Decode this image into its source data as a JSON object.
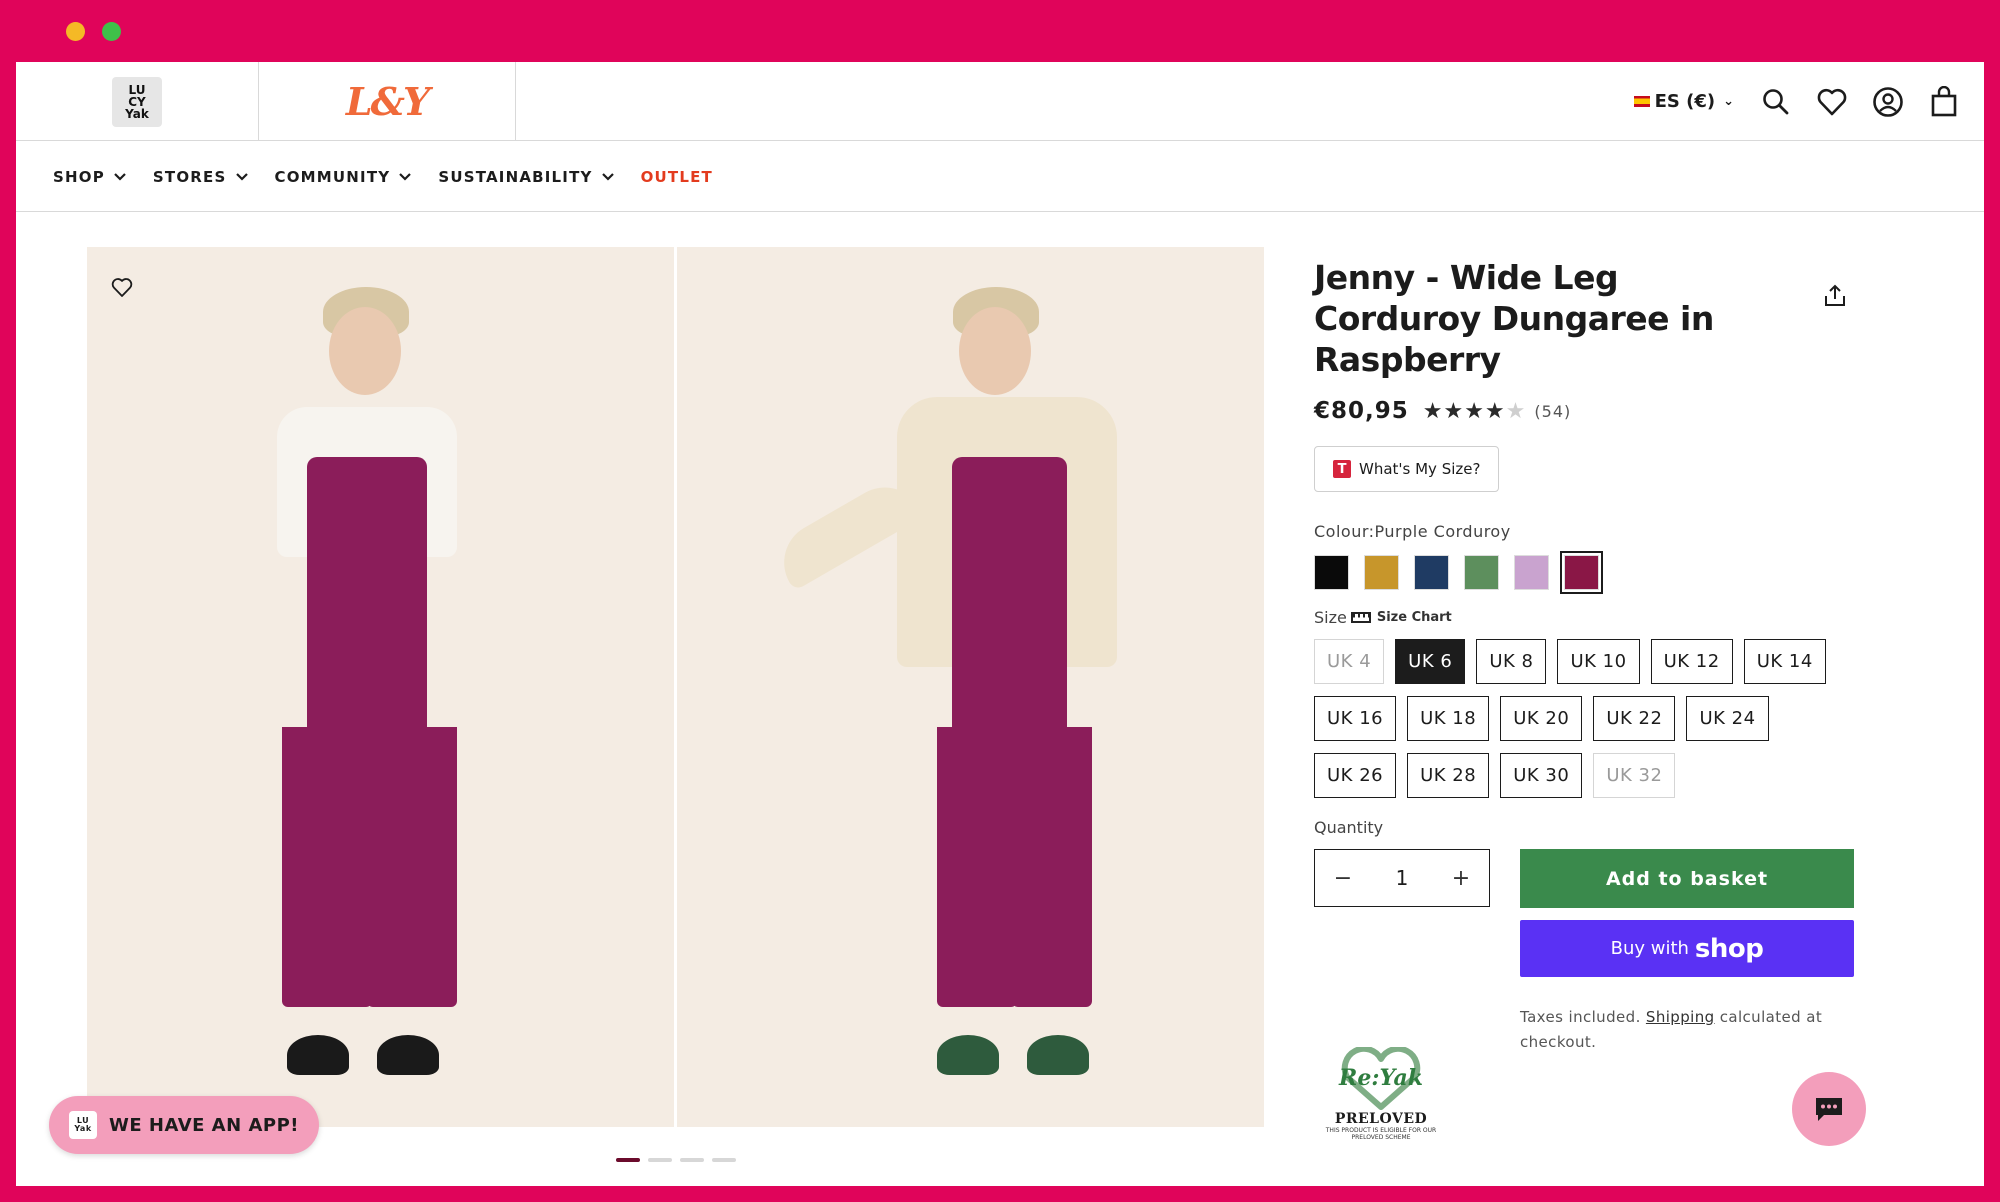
{
  "colors": {
    "frame": "#e0045a",
    "add_button": "#3a8a4c",
    "shop_button": "#5a31f4",
    "outlet": "#e33b1e",
    "app_pill": "#f39ebb"
  },
  "header": {
    "locale": "ES (€)",
    "icons": [
      "search-icon",
      "heart-icon",
      "account-icon",
      "bag-icon"
    ]
  },
  "nav": {
    "items": [
      {
        "label": "SHOP",
        "has_dropdown": true
      },
      {
        "label": "STORES",
        "has_dropdown": true
      },
      {
        "label": "COMMUNITY",
        "has_dropdown": true
      },
      {
        "label": "SUSTAINABILITY",
        "has_dropdown": true
      },
      {
        "label": "OUTLET",
        "has_dropdown": false
      }
    ]
  },
  "gallery": {
    "pages": 4,
    "current_page": 1
  },
  "product": {
    "title": "Jenny - Wide Leg Corduroy Dungaree in Raspberry",
    "price": "€80,95",
    "rating": 4,
    "rating_max": 5,
    "reviews": "(54)",
    "size_tool": "What's My Size?",
    "colour_label": "Colour:",
    "colour_value": "Purple Corduroy",
    "swatches": [
      {
        "name": "black",
        "color": "#0a0a0a"
      },
      {
        "name": "mustard",
        "color": "#c7962b"
      },
      {
        "name": "navy",
        "color": "#1f3b63"
      },
      {
        "name": "green-print",
        "color": "#5d8f5d"
      },
      {
        "name": "lilac-floral",
        "color": "#c9a3cf"
      },
      {
        "name": "raspberry",
        "color": "#8a1746",
        "selected": true
      }
    ],
    "size_label": "Size",
    "size_chart": "Size Chart",
    "sizes": [
      {
        "label": "UK 4",
        "state": "disabled"
      },
      {
        "label": "UK 6",
        "state": "selected"
      },
      {
        "label": "UK 8",
        "state": "available"
      },
      {
        "label": "UK 10",
        "state": "available"
      },
      {
        "label": "UK 12",
        "state": "available"
      },
      {
        "label": "UK 14",
        "state": "available"
      },
      {
        "label": "UK 16",
        "state": "available"
      },
      {
        "label": "UK 18",
        "state": "available"
      },
      {
        "label": "UK 20",
        "state": "available"
      },
      {
        "label": "UK 22",
        "state": "available"
      },
      {
        "label": "UK 24",
        "state": "available"
      },
      {
        "label": "UK 26",
        "state": "available"
      },
      {
        "label": "UK 28",
        "state": "available"
      },
      {
        "label": "UK 30",
        "state": "available"
      },
      {
        "label": "UK 32",
        "state": "disabled"
      }
    ],
    "quantity_label": "Quantity",
    "quantity": "1",
    "add_to_basket": "Add to basket",
    "buy_with": "Buy with",
    "shop_brand": "shop",
    "tax_text_1": "Taxes included.",
    "shipping_link": "Shipping",
    "tax_text_2": "calculated at checkout."
  },
  "preloved": {
    "logo_text": "Re:Yak",
    "label": "PRELOVED",
    "note": "THIS PRODUCT IS ELIGIBLE FOR OUR PRELOVED SCHEME"
  },
  "app_banner": {
    "label": "WE HAVE AN APP!"
  }
}
